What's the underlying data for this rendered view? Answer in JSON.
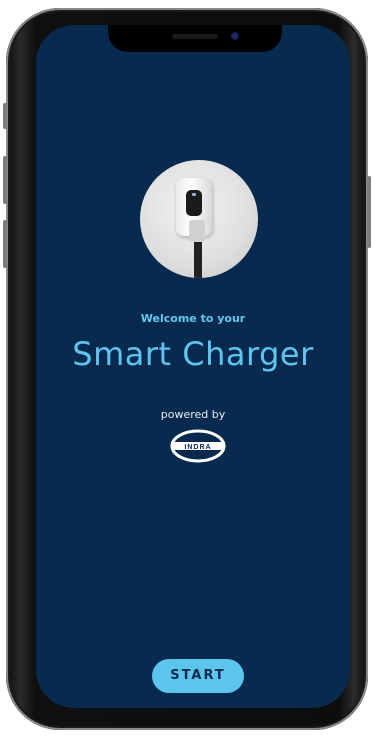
{
  "app": {
    "welcome_text": "Welcome to your",
    "title": "Smart Charger",
    "powered_by": "powered by",
    "brand_logo_text": "INDRA",
    "start_label": "START"
  },
  "colors": {
    "screen_bg": "#082a4e",
    "accent": "#5fc4ef",
    "button_text": "#0a2a4e"
  }
}
